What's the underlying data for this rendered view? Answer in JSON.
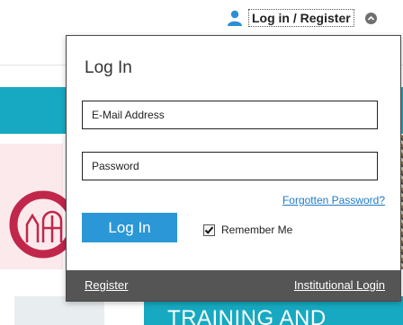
{
  "header": {
    "login_register_label": "Log in / Register",
    "icons": {
      "user": "user-icon",
      "toggle": "chevron-down-icon"
    }
  },
  "login_popup": {
    "title": "Log In",
    "email_placeholder": "E-Mail Address",
    "email_value": "",
    "password_placeholder": "Password",
    "password_value": "",
    "forgot_password_label": "Forgotten Password?",
    "login_button_label": "Log In",
    "remember_me_label": "Remember Me",
    "remember_me_checked": true,
    "footer": {
      "register_label": "Register",
      "institutional_login_label": "Institutional Login"
    }
  },
  "background": {
    "banner_text": "TRAINING AND"
  },
  "colors": {
    "accent_teal": "#16a9c1",
    "button_blue": "#2b97d6",
    "link_blue": "#1f7bc6",
    "footer_gray": "#555555",
    "emblem_red": "#c0274a"
  }
}
